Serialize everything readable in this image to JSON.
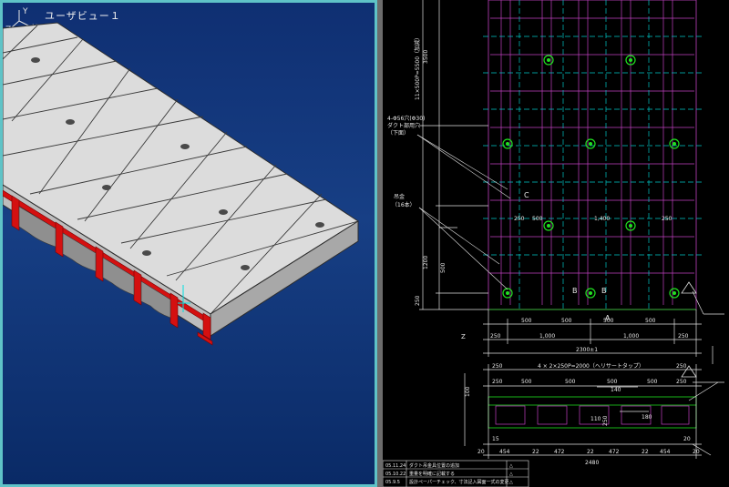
{
  "viewport3d": {
    "title": "ユーザビュー１",
    "axes": {
      "y": "Y",
      "z": "Z",
      "x": "X"
    }
  },
  "cad": {
    "dims": {
      "v3500": "3500",
      "vBolt": "11×500P=5500（加減）",
      "v1200": "1200",
      "v500": "500",
      "v250": "250",
      "h250a": "250",
      "h500a": "500",
      "h500b": "500",
      "h500c": "500",
      "h500d": "500",
      "h250b": "250",
      "h1000a": "1,000",
      "h1000b": "1,000",
      "hTotal": "2300±1",
      "m250": "250",
      "m500": "500",
      "m1400": "1,400",
      "m250b": "250",
      "s250a": "250",
      "s250b": "250",
      "sBar": "4 × 2×250P=2000（ヘリサートタップ）",
      "s250c": "250",
      "s250d": "250",
      "s500a": "500",
      "s500b": "500",
      "s500c": "500",
      "s500d": "500",
      "s20a": "20",
      "s20b": "20",
      "s454a": "454",
      "s22a": "22",
      "s472a": "472",
      "s22b": "22",
      "s472b": "472",
      "s22c": "22",
      "s454b": "454",
      "s2480": "2480",
      "d100": "100",
      "d140": "140",
      "d110": "110",
      "d250": "250",
      "d180": "180",
      "d15": "15",
      "d20": "20"
    },
    "notes": {
      "holesTitle": "4-Φ56穴(Φ30)",
      "holesLine2": "ダクト部用穴",
      "holesLine3": "（下面）",
      "anchor": "吊金",
      "anchorCount": "（16本）",
      "markA": "A",
      "markB": "B",
      "markB2": "B",
      "markC": "C",
      "markZ": "Z"
    },
    "revisions": [
      {
        "date": "05.11.24",
        "desc": "ダクト吊金具位置の追加",
        "mark": "△"
      },
      {
        "date": "05.10.22",
        "desc": "重量を明確に記載する",
        "mark": "△"
      },
      {
        "date": "05.9.5",
        "desc": "設計ペーパーチェック、寸法記入図面一式の変更",
        "mark": "△"
      }
    ]
  }
}
